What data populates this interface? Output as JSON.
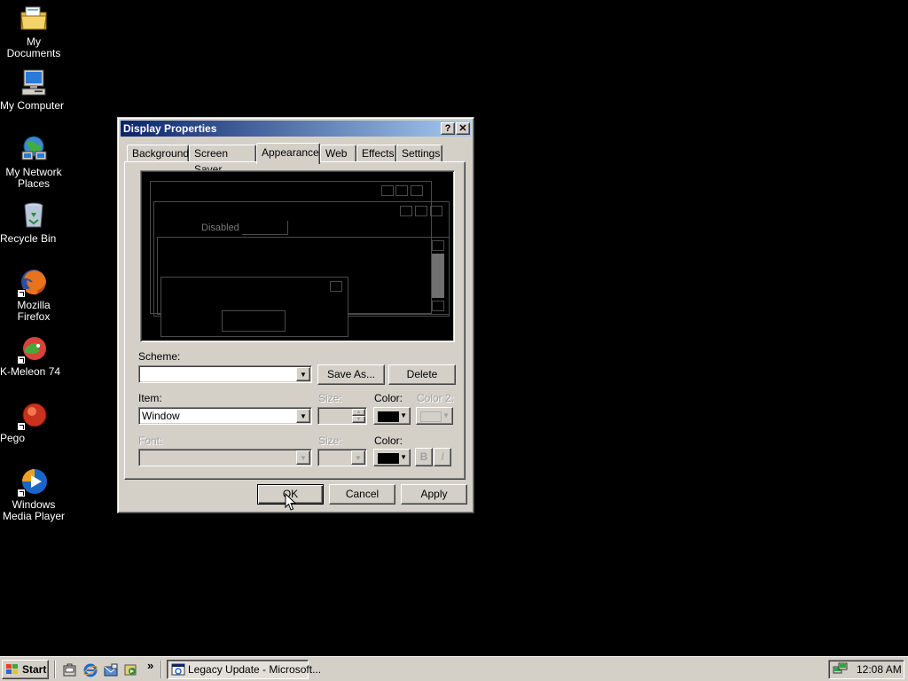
{
  "desktop": {
    "icons": [
      {
        "label": "My Documents",
        "icon": "folder-documents-icon"
      },
      {
        "label": "My Computer",
        "icon": "computer-icon"
      },
      {
        "label": "My Network Places",
        "icon": "network-places-icon"
      },
      {
        "label": "Recycle Bin",
        "icon": "recycle-bin-icon"
      },
      {
        "label": "Mozilla Firefox",
        "icon": "firefox-icon"
      },
      {
        "label": "K-Meleon 74",
        "icon": "k-meleon-icon"
      },
      {
        "label": "Pego",
        "icon": "pego-icon"
      },
      {
        "label": "Windows Media Player",
        "icon": "media-player-icon"
      }
    ]
  },
  "dialog": {
    "title": "Display Properties",
    "help_glyph": "?",
    "close_glyph": "✕",
    "tabs": [
      {
        "label": "Background",
        "active": false
      },
      {
        "label": "Screen Saver",
        "active": false
      },
      {
        "label": "Appearance",
        "active": true
      },
      {
        "label": "Web",
        "active": false
      },
      {
        "label": "Effects",
        "active": false
      },
      {
        "label": "Settings",
        "active": false
      }
    ],
    "preview": {
      "disabled_label": "Disabled"
    },
    "scheme": {
      "label": "Scheme:",
      "value": "",
      "save_as": "Save As...",
      "delete": "Delete"
    },
    "item": {
      "label": "Item:",
      "value": "Window",
      "size_label": "Size:",
      "color_label": "Color:",
      "color2_label": "Color 2:",
      "color_value": "#000000"
    },
    "font": {
      "label": "Font:",
      "value": "",
      "size_label": "Size:",
      "color_label": "Color:",
      "color_value": "#000000",
      "bold": "B",
      "italic": "I"
    },
    "buttons": {
      "ok": "OK",
      "cancel": "Cancel",
      "apply": "Apply"
    }
  },
  "taskbar": {
    "start_label": "Start",
    "quick_launch": [
      "show-desktop-icon",
      "internet-explorer-icon",
      "outlook-express-icon",
      "media-icon"
    ],
    "chevron": "»",
    "task_button": "Legacy Update - Microsoft...",
    "clock": "12:08 AM"
  },
  "colors": {
    "desktop_background": "#000000",
    "titlebar_start": "#0a246a",
    "titlebar_end": "#a6caf0",
    "face": "#d4d0c8"
  }
}
